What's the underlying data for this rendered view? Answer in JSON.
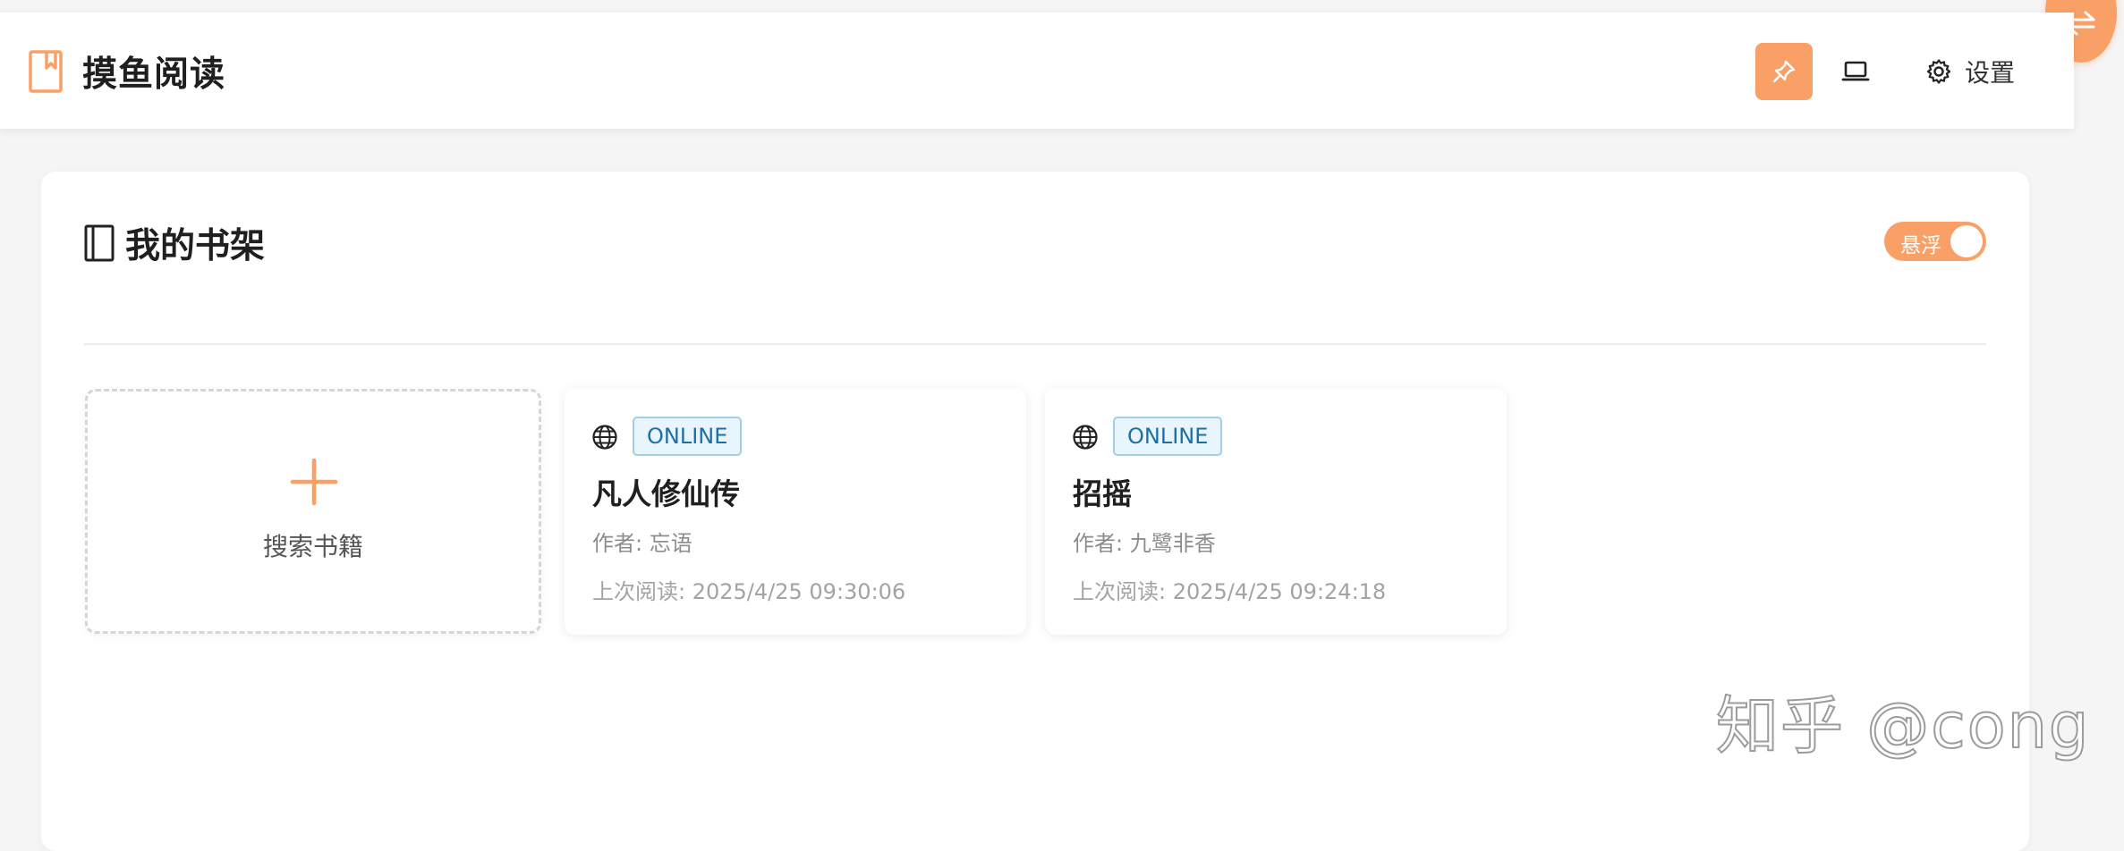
{
  "header": {
    "title": "摸鱼阅读",
    "settings_label": "设置",
    "pin_icon": "pin-icon",
    "laptop_icon": "laptop-icon",
    "settings_icon": "gear-icon"
  },
  "colors": {
    "accent": "#f9a066",
    "badge_border": "#9fd0ea",
    "badge_bg": "#e8f5fc",
    "badge_text": "#1d6fa5"
  },
  "shelf": {
    "title": "我的书架",
    "float_toggle_label": "悬浮",
    "float_toggle_on": true,
    "add_card_label": "搜索书籍",
    "books": [
      {
        "source": "ONLINE",
        "title": "凡人修仙传",
        "author": "作者: 忘语",
        "last_read": "上次阅读: 2025/4/25 09:30:06"
      },
      {
        "source": "ONLINE",
        "title": "招摇",
        "author": "作者: 九鹭非香",
        "last_read": "上次阅读: 2025/4/25 09:24:18"
      }
    ]
  },
  "watermark": "知乎 @cong"
}
